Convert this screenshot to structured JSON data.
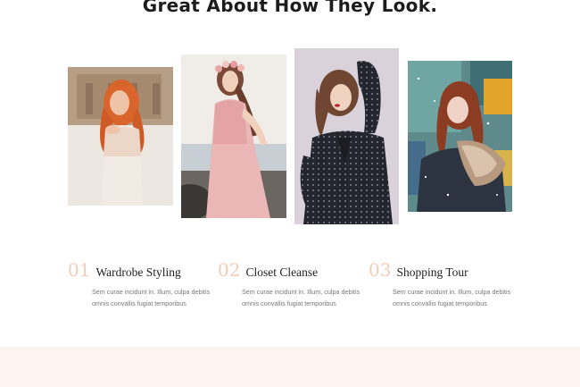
{
  "section": {
    "heading": "Great About How They Look."
  },
  "gallery": {
    "photos": [
      {
        "alt": "Woman with red hair in a white lace top in an old square",
        "icon": "photo-red-hair-woman"
      },
      {
        "alt": "Woman in a pink chiffon dress with a flower crown at the seaside",
        "icon": "photo-flower-crown-woman"
      },
      {
        "alt": "Woman in a black polka-dot blouse against a lilac wall",
        "icon": "photo-polka-dot-woman"
      },
      {
        "alt": "Woman in a fur-collar jacket in falling snow",
        "icon": "photo-winter-woman"
      }
    ]
  },
  "services": [
    {
      "number": "01",
      "title": "Wardrobe Styling",
      "text": "Sem curae incidunt in. Illum, culpa debitis omnis convallis fugiat temporibus"
    },
    {
      "number": "02",
      "title": "Closet Cleanse",
      "text": "Sem curae incidunt in. Illum, culpa debitis omnis convallis fugiat temporibus"
    },
    {
      "number": "03",
      "title": "Shopping Tour",
      "text": "Sem curae incidunt in. Illum, culpa debitis omnis convallis fugiat temporibus"
    }
  ],
  "colors": {
    "number_accent": "#f2cdb8",
    "footer_band": "#fdf4ef"
  }
}
